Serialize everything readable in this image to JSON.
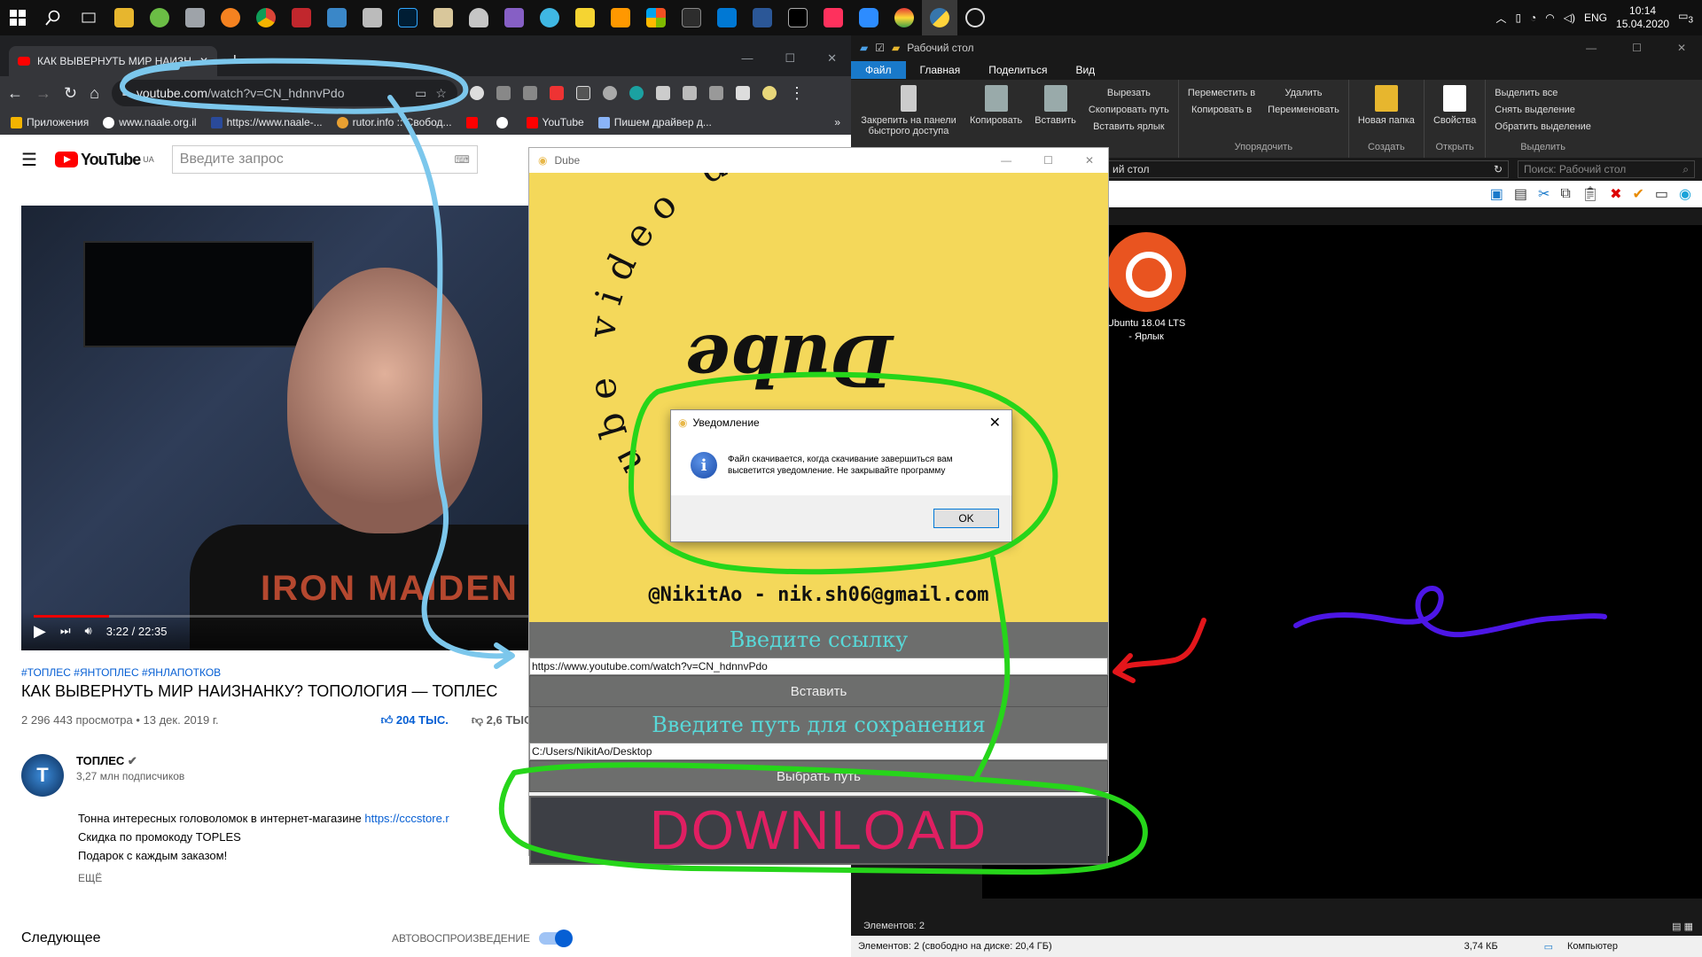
{
  "taskbar": {
    "apps": [
      "start",
      "search",
      "task-view",
      "file-explorer",
      "utorrent",
      "app",
      "avast",
      "chrome",
      "aida64",
      "network-tool",
      "pen-tool",
      "photoshop",
      "pen",
      "mushroom-app",
      "visual-studio",
      "timer",
      "potplayer",
      "sublime-text",
      "office",
      "terminal",
      "vscode",
      "save-disk",
      "cmd",
      "intellij",
      "zoom",
      "color-wheel",
      "python-idle",
      "clock-app"
    ],
    "tray": {
      "lang": "ENG",
      "time": "10:14",
      "date": "15.04.2020",
      "notifications": "3"
    }
  },
  "chrome": {
    "tab_title": "КАК ВЫВЕРНУТЬ МИР НАИЗНАН",
    "url_host": "youtube.com",
    "url_path": "/watch?v=CN_hdnnvPdo",
    "bookmarks": [
      "Приложения",
      "www.naale.org.il",
      "https://www.naale-...",
      "rutor.info :: Свобод...",
      "",
      "",
      "YouTube",
      "Пишем драйвер д..."
    ]
  },
  "youtube": {
    "logo_text": "YouTube",
    "logo_region": "UA",
    "search_placeholder": "Введите запрос",
    "video": {
      "time": "3:22 / 22:35",
      "progress": 0.149,
      "shirt_print": "IRON MAIDEN"
    },
    "hashtags": "#ТОПЛЕС #ЯНТОПЛЕС #ЯНЛАПОТКОВ",
    "title": "КАК ВЫВЕРНУТЬ МИР НАИЗНАНКУ? ТОПОЛОГИЯ — ТОПЛЕС",
    "meta": "2 296 443 просмотра • 13 дек. 2019 г.",
    "likes": "204 ТЫС.",
    "dislikes": "2,6 ТЫС.",
    "channel": {
      "name": "ТОПЛЕС",
      "subs": "3,27 млн подписчиков",
      "avatar": "T"
    },
    "desc_line1": "Тонна интересных головоломок в интернет-магазине ",
    "desc_link": "https://cccstore.r",
    "desc_line2": "Скидка по промокоду TOPLES",
    "desc_line3": "Подарок с каждым заказом!",
    "more": "ЕЩЁ",
    "up_next": "Следующее",
    "autoplay": "АВТОВОСПРОИЗВЕДЕНИЕ"
  },
  "explorer": {
    "title": "Рабочий стол",
    "tabs": [
      "Файл",
      "Главная",
      "Поделиться",
      "Вид"
    ],
    "ribbon": {
      "pin": "Закрепить на панели быстрого доступа",
      "copy": "Копировать",
      "paste": "Вставить",
      "cut": "Вырезать",
      "copy_path": "Скопировать путь",
      "paste_shortcut": "Вставить ярлык",
      "move_to": "Переместить в",
      "copy_to": "Копировать в",
      "delete": "Удалить",
      "rename": "Переименовать",
      "new_folder": "Новая папка",
      "properties": "Свойства",
      "select_all": "Выделить все",
      "select_none": "Снять выделение",
      "invert": "Обратить выделение",
      "group_organize": "Упорядочить",
      "group_create": "Создать",
      "group_open": "Открыть",
      "group_select": "Выделить"
    },
    "path": "ий стол",
    "search_placeholder": "Поиск: Рабочий стол",
    "desktop_item": "Ubuntu 18.04 LTS - Ярлык",
    "status_items": "Элементов: 2",
    "status_bar": "Элементов: 2 (свободно на диске: 20,4 ГБ)",
    "status_size": "3,74 КБ",
    "status_computer": "Компьютер"
  },
  "dube": {
    "title": "Dube",
    "banner_arc": "ube video downl",
    "banner_logo": "Dube",
    "banner_credit": "@NikitAo - nik.sh06@gmail.com",
    "label_link": "Введите ссылку",
    "link_value": "https://www.youtube.com/watch?v=CN_hdnnvPdo",
    "paste_button": "Вставить",
    "label_path": "Введите путь для сохранения",
    "path_value": "C:/Users/NikitAo/Desktop",
    "choose_path_button": "Выбрать путь",
    "download_button": "DOWNLOAD"
  },
  "dialog": {
    "title": "Уведомление",
    "message": "Файл скачивается, когда скачивание завершиться вам высветится уведомление. Не закрывайте программу",
    "ok": "OK"
  },
  "colors": {
    "annotation_blue": "#7cc7ec",
    "annotation_green": "#26d51a",
    "annotation_red": "#e3161b",
    "annotation_purple": "#4c16e6",
    "dube_yellow": "#f4d85a",
    "download_pink": "#e01f62"
  }
}
